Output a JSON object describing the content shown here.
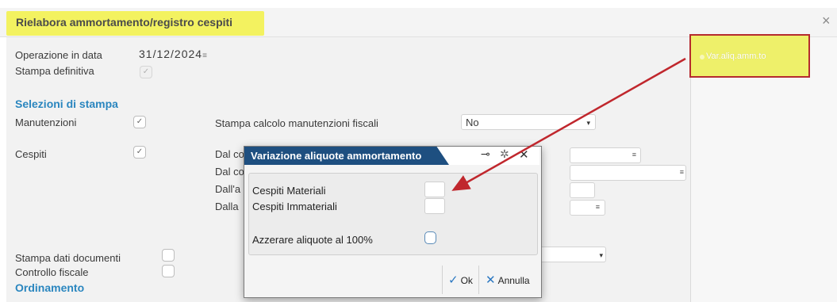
{
  "window": {
    "title": "Rielabora ammortamento/registro cespiti",
    "close_icon": "×"
  },
  "form": {
    "operazione_label": "Operazione in data",
    "operazione_value": "31/12/2024",
    "operazione_icon": "≡",
    "stampa_definitiva_label": "Stampa definitiva",
    "stampa_definitiva_check": "✓",
    "section_selezioni": "Selezioni di stampa",
    "manutenzioni_label": "Manutenzioni",
    "manutenzioni_check": "✓",
    "stampa_calcolo_label": "Stampa calcolo manutenzioni fiscali",
    "stampa_calcolo_value": "No",
    "cespiti_label": "Cespiti",
    "cespiti_check": "✓",
    "dal_labels": [
      "Dal co",
      "Dal co",
      "Dall'a",
      "Dalla"
    ],
    "field_icon": "≡",
    "stampa_dati_label": "Stampa dati documenti",
    "controllo_label": "Controllo fiscale",
    "section_ordinamento": "Ordinamento",
    "caret": "▾"
  },
  "right_panel": {
    "var_button_label": "Var.aliq.amm.to",
    "highlight_color": "#eef06a",
    "border_color": "#b52b2f"
  },
  "dialog": {
    "title": "Variazione aliquote ammortamento",
    "pin_icon": "⊸",
    "expand_icon": "✲",
    "close_icon": "✕",
    "materiali_label": "Cespiti Materiali",
    "immateriali_label": "Cespiti Immateriali",
    "azzerare_label": "Azzerare aliquote al 100%",
    "ok_icon": "✓",
    "ok_label": "Ok",
    "annulla_icon": "✕",
    "annulla_label": "Annulla",
    "header_color": "#1e4f80"
  }
}
